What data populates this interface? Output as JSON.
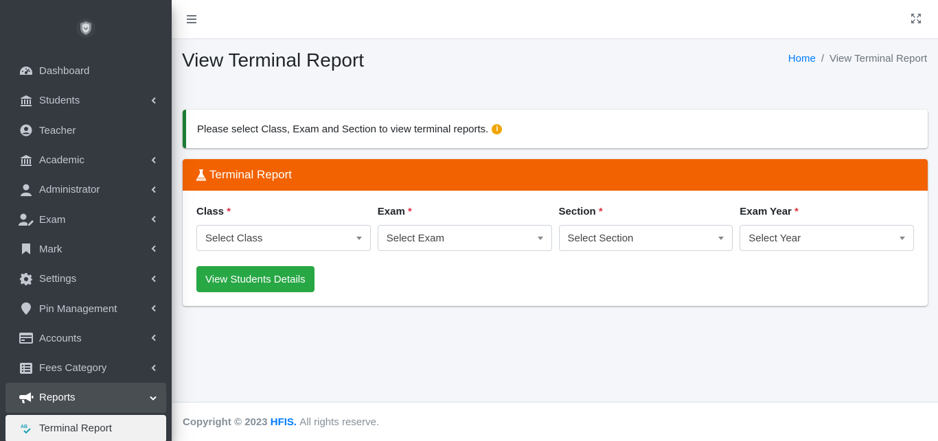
{
  "sidebar": {
    "logo": "shield-logo",
    "items": [
      {
        "label": "Dashboard",
        "icon": "tachometer-icon",
        "has_submenu": false
      },
      {
        "label": "Students",
        "icon": "university-icon",
        "has_submenu": true
      },
      {
        "label": "Teacher",
        "icon": "user-circle-icon",
        "has_submenu": false
      },
      {
        "label": "Academic",
        "icon": "university-icon",
        "has_submenu": true
      },
      {
        "label": "Administrator",
        "icon": "user-icon",
        "has_submenu": true
      },
      {
        "label": "Exam",
        "icon": "user-edit-icon",
        "has_submenu": true
      },
      {
        "label": "Mark",
        "icon": "bookmark-icon",
        "has_submenu": true
      },
      {
        "label": "Settings",
        "icon": "gear-icon",
        "has_submenu": true
      },
      {
        "label": "Pin Management",
        "icon": "map-pin-icon",
        "has_submenu": true
      },
      {
        "label": "Accounts",
        "icon": "credit-card-icon",
        "has_submenu": true
      },
      {
        "label": "Fees Category",
        "icon": "list-alt-icon",
        "has_submenu": true
      },
      {
        "label": "Reports",
        "icon": "bullhorn-icon",
        "has_submenu": true,
        "open": true
      },
      {
        "label": "Terminal Report",
        "icon": "spell-check-icon",
        "active": true
      }
    ]
  },
  "topbar": {
    "menu_icon": "hamburger-icon",
    "fullscreen_icon": "expand-icon"
  },
  "header": {
    "title": "View Terminal Report",
    "breadcrumb": {
      "home": "Home",
      "separator": "/",
      "current": "View Terminal Report"
    }
  },
  "callout": {
    "text": "Please select Class, Exam and Section to view terminal reports.",
    "icon": "info-circle-icon",
    "border_color": "#1e7e34"
  },
  "card": {
    "title": "Terminal Report",
    "header_color": "#f26200",
    "fields": [
      {
        "label": "Class",
        "required": "*",
        "placeholder": "Select Class"
      },
      {
        "label": "Exam",
        "required": "*",
        "placeholder": "Select Exam"
      },
      {
        "label": "Section",
        "required": "*",
        "placeholder": "Select Section"
      },
      {
        "label": "Exam Year",
        "required": "*",
        "placeholder": "Select Year"
      }
    ],
    "submit_label": "View Students Details"
  },
  "footer": {
    "prefix": "Copyright © 2023",
    "brand": "HFIS.",
    "suffix": "All rights reserve."
  },
  "colors": {
    "sidebar_bg": "#343a40",
    "accent_orange": "#f26200",
    "success": "#28a745",
    "link": "#007bff",
    "required": "#dc3545"
  }
}
